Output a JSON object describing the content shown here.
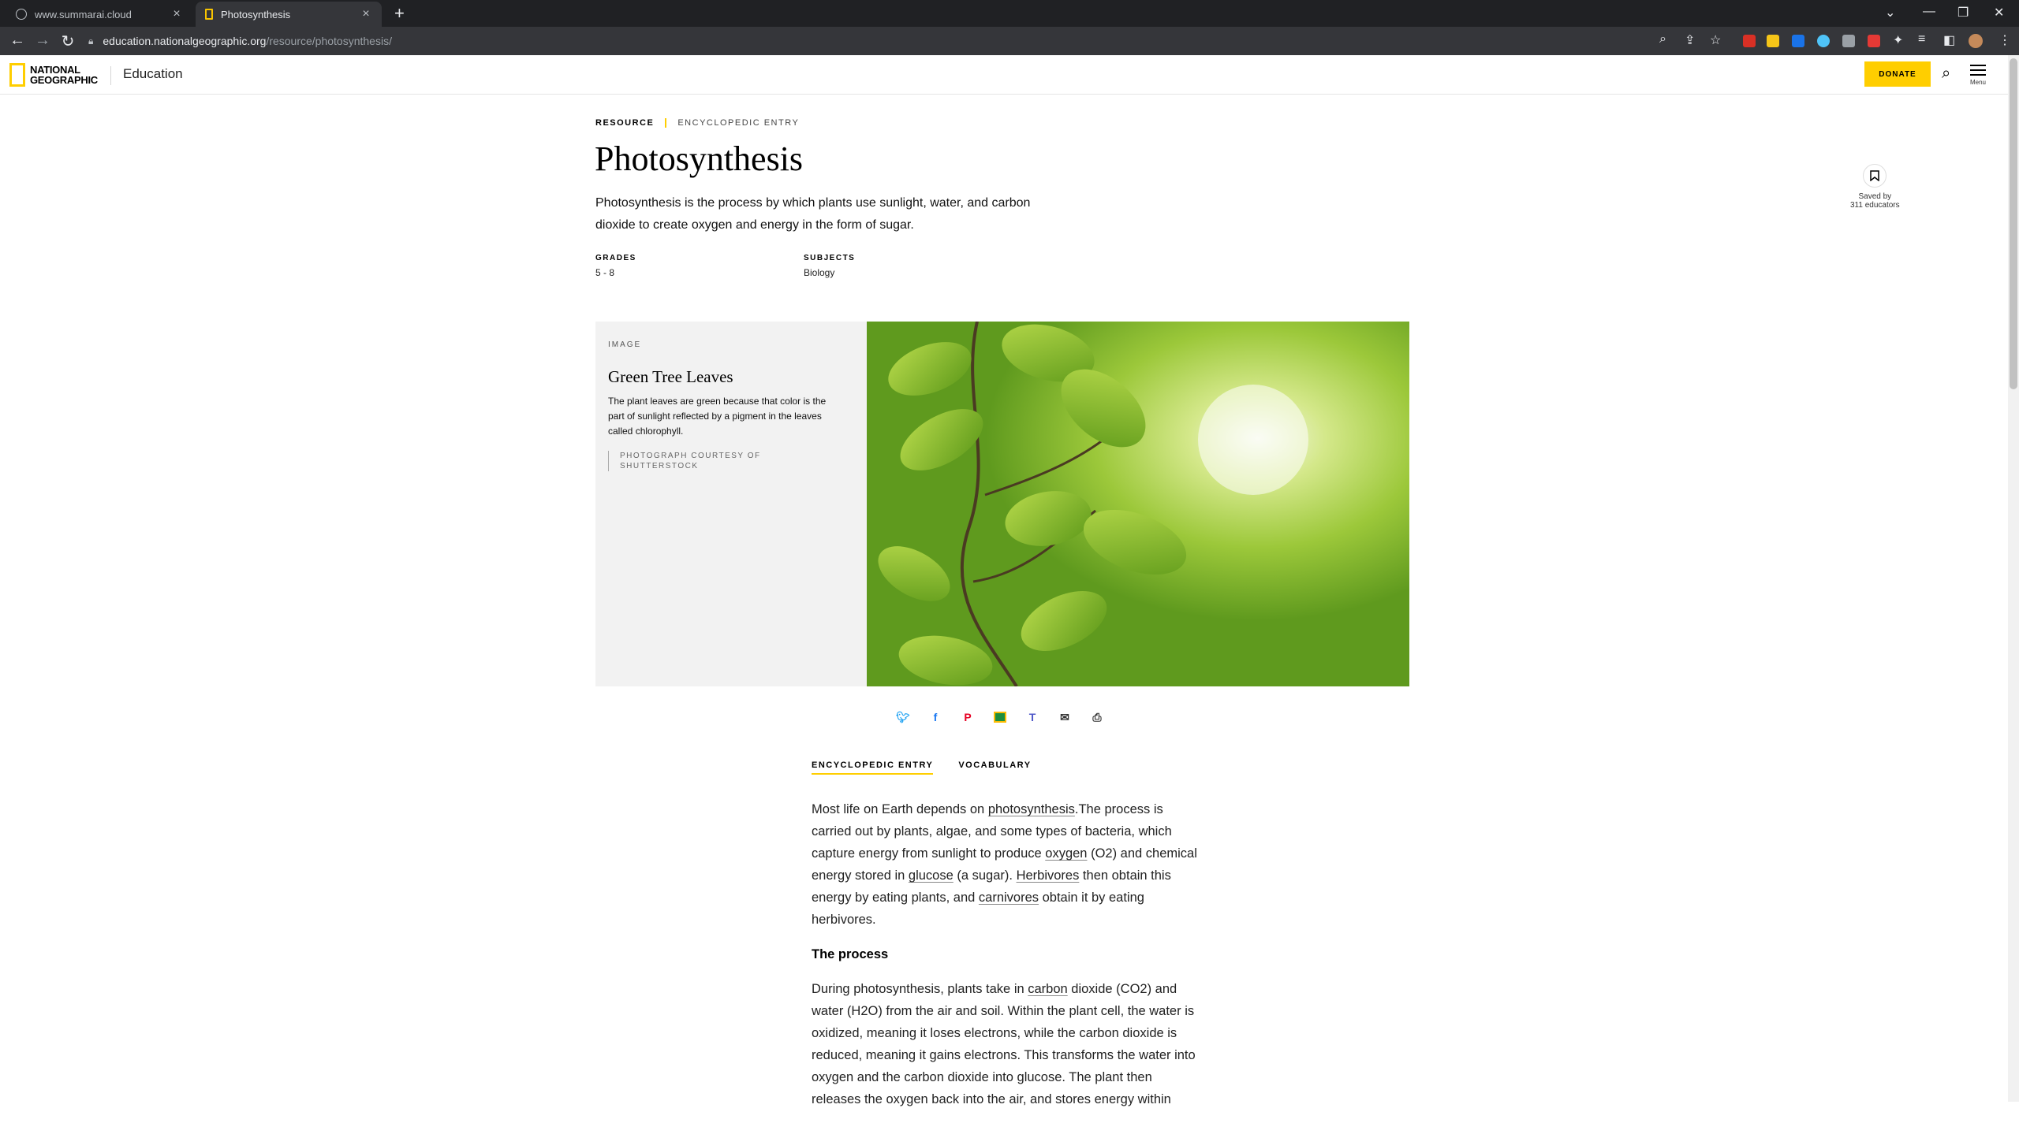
{
  "browser": {
    "tabs": [
      {
        "title": "www.summarai.cloud"
      },
      {
        "title": "Photosynthesis"
      }
    ],
    "url_host": "education.nationalgeographic.org",
    "url_path": "/resource/photosynthesis/"
  },
  "header": {
    "logo_line1": "NATIONAL",
    "logo_line2": "GEOGRAPHIC",
    "section": "Education",
    "donate": "DONATE",
    "menu_label": "Menu"
  },
  "article": {
    "eyebrow_type": "RESOURCE",
    "eyebrow_kind": "ENCYCLOPEDIC ENTRY",
    "title": "Photosynthesis",
    "lede": "Photosynthesis is the process by which plants use sunlight, water, and carbon dioxide to create oxygen and energy in the form of sugar.",
    "grades_label": "GRADES",
    "grades_value": "5 - 8",
    "subjects_label": "SUBJECTS",
    "subjects_value": "Biology",
    "saved_line1": "Saved by",
    "saved_line2": "311 educators"
  },
  "media": {
    "label": "IMAGE",
    "title": "Green Tree Leaves",
    "caption": "The plant leaves are green because that color is the part of sunlight reflected by a pigment in the leaves called chlorophyll.",
    "credit": "PHOTOGRAPH COURTESY OF SHUTTERSTOCK"
  },
  "share_icons": [
    "twitter-icon",
    "facebook-icon",
    "pinterest-icon",
    "google-classroom-icon",
    "teams-icon",
    "email-icon",
    "print-icon"
  ],
  "tabs": [
    {
      "label": "ENCYCLOPEDIC ENTRY"
    },
    {
      "label": "VOCABULARY"
    }
  ],
  "body": {
    "p1_a": "Most life on Earth depends on ",
    "p1_l1": "photosynthesis",
    "p1_b": ".The process is carried out by plants, algae, and some types of bacteria, which capture energy from sunlight to produce ",
    "p1_l2": "oxygen",
    "p1_c": " (O2) and chemical energy stored in ",
    "p1_l3": "glucose",
    "p1_d": " (a sugar). ",
    "p1_l4": "Herbivores",
    "p1_e": " then obtain this energy by eating plants, and ",
    "p1_l5": "carnivores",
    "p1_f": " obtain it by eating herbivores.",
    "h_process": "The process",
    "p2_a": "During photosynthesis, plants take in ",
    "p2_l1": "carbon",
    "p2_b": " dioxide (CO2) and water (H2O) from the air and soil. Within the plant cell, the water is oxidized, meaning it loses electrons, while the carbon dioxide is reduced, meaning it gains electrons. This transforms the water into oxygen and the carbon dioxide into glucose. The plant then releases the oxygen back into the air, and stores energy within"
  }
}
